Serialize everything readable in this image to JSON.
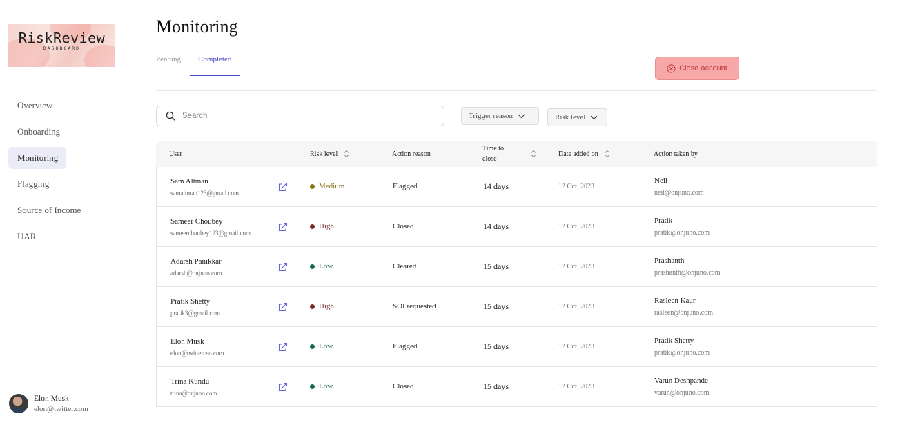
{
  "brand": {
    "title": "RiskReview",
    "subtitle": "DASHBOARD"
  },
  "sidebar": {
    "items": [
      {
        "label": "Overview",
        "active": false
      },
      {
        "label": "Onboarding",
        "active": false
      },
      {
        "label": "Monitoring",
        "active": true
      },
      {
        "label": "Flagging",
        "active": false
      },
      {
        "label": "Source of Income",
        "active": false
      },
      {
        "label": "UAR",
        "active": false
      }
    ],
    "profile": {
      "name": "Elon Musk",
      "email": "elon@twitter.com"
    }
  },
  "main": {
    "title": "Monitoring",
    "tabs": [
      {
        "label": "Pending",
        "active": false
      },
      {
        "label": "Completed",
        "active": true
      }
    ],
    "close_button": "Close account",
    "search": {
      "placeholder": "Search",
      "value": ""
    },
    "filters": {
      "trigger": "Trigger reason",
      "risk": "Risk level"
    }
  },
  "table": {
    "headers": {
      "user": "User",
      "risk": "Risk level",
      "reason": "Action reason",
      "time_line1": "Time to",
      "time_line2": "close",
      "date": "Date added on",
      "by": "Action taken by"
    },
    "rows": [
      {
        "name": "Sam Altman",
        "email": "samaltman123@gmail.com",
        "risk": "Medium",
        "risk_color": "#8a7414",
        "reason": "Flagged",
        "time": "14 days",
        "date": "12 Oct, 2023",
        "by_name": "Neil",
        "by_email": "neil@onjuno.com"
      },
      {
        "name": "Sameer Choubey",
        "email": "sameerchoubey123@gmail.com",
        "risk": "High",
        "risk_color": "#7a2a2a",
        "reason": "Closed",
        "time": "14 days",
        "date": "12 Oct, 2023",
        "by_name": "Pratik",
        "by_email": "pratik@onjuno.com"
      },
      {
        "name": "Adarsh Panikkar",
        "email": "adarsh@onjuno.com",
        "risk": "Low",
        "risk_color": "#17694a",
        "reason": "Cleared",
        "time": "15 days",
        "date": "12 Oct, 2023",
        "by_name": "Prashanth",
        "by_email": "prashanth@onjuno.com"
      },
      {
        "name": "Pratik Shetty",
        "email": "pratik3@gmail.com",
        "risk": "High",
        "risk_color": "#7a2a2a",
        "reason": "SOI requested",
        "time": "15 days",
        "date": "12 Oct, 2023",
        "by_name": "Rasleen Kaur",
        "by_email": "rasleen@onjuno.com"
      },
      {
        "name": "Elon Musk",
        "email": "elon@twitterceo.com",
        "risk": "Low",
        "risk_color": "#17694a",
        "reason": "Flagged",
        "time": "15 days",
        "date": "12 Oct, 2023",
        "by_name": "Pratik Shetty",
        "by_email": "pratik@onjuno.com"
      },
      {
        "name": "Trina Kundu",
        "email": "trina@onjuno.com",
        "risk": "Low",
        "risk_color": "#17694a",
        "reason": "Closed",
        "time": "15 days",
        "date": "12 Oct, 2023",
        "by_name": "Varun Deshpande",
        "by_email": "varun@onjuno.com"
      }
    ]
  },
  "colors": {
    "accent": "#4a45c8",
    "danger_bg": "#f7a9a9",
    "danger_text": "#c33a3a",
    "nav_active_bg": "#ececf8"
  }
}
